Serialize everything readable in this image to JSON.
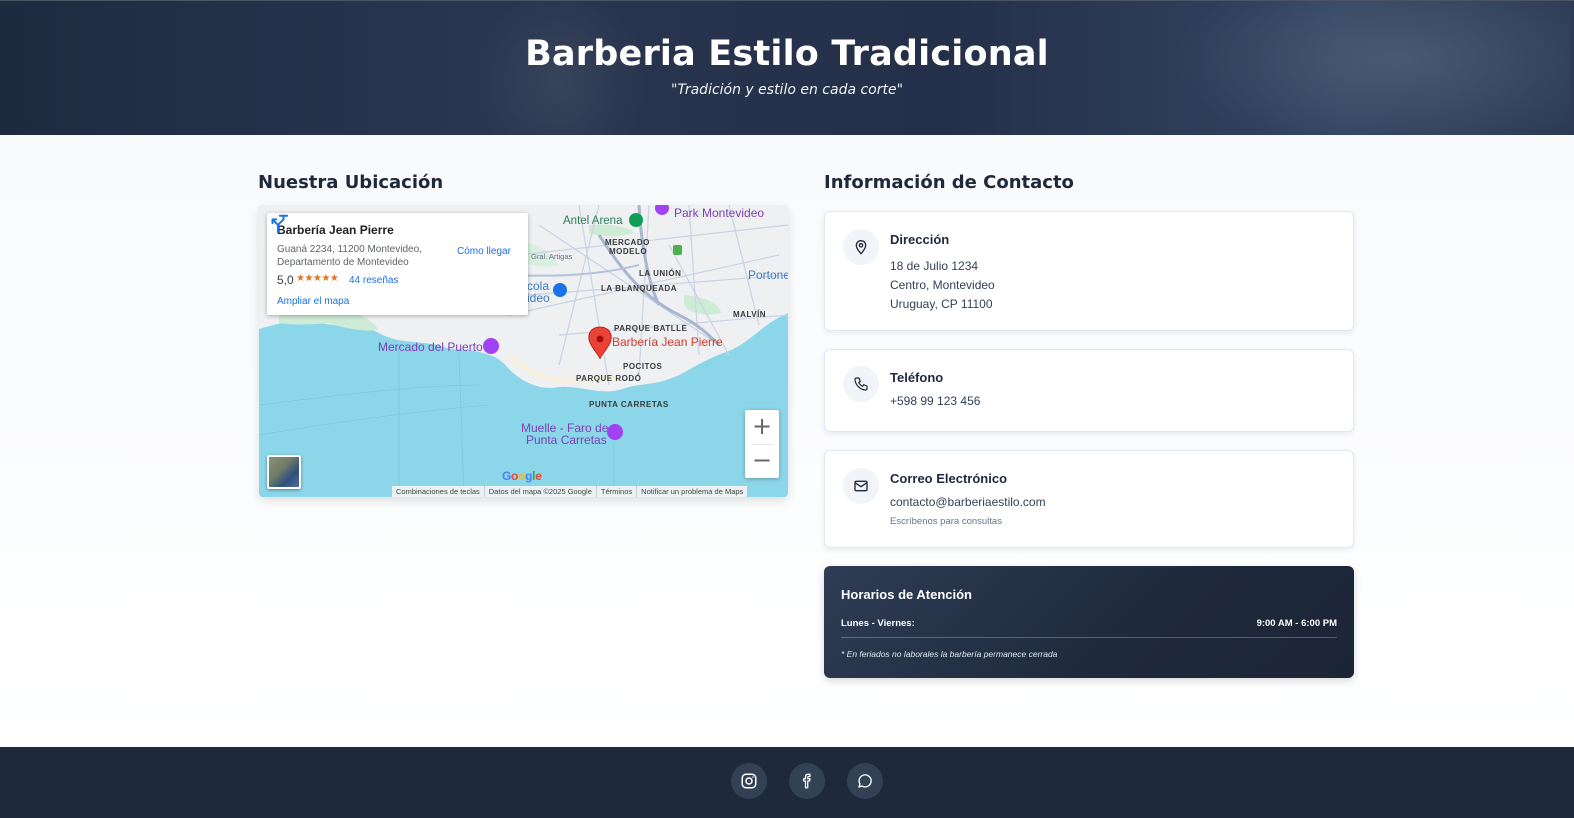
{
  "header": {
    "title": "Barberia Estilo Tradicional",
    "subtitle": "\"Tradición y estilo en cada corte\""
  },
  "location": {
    "section_title": "Nuestra Ubicación",
    "map": {
      "place_card": {
        "name": "Barbería Jean Pierre",
        "address": "Guaná 2234, 11200 Montevideo, Departamento de Montevideo",
        "rating": "5,0",
        "stars": "★★★★★",
        "reviews": "44 reseñas",
        "enlarge": "Ampliar el mapa",
        "directions": "Cómo llegar"
      },
      "labels": {
        "antel_arena": "Antel Arena",
        "park_montevideo": "Park Montevideo",
        "mercado_modelo_1": "MERCADO",
        "mercado_modelo_2": "MODELO",
        "gral_artigas": "Gral. Artigas",
        "la_union": "LA UNIÓN",
        "la_blanqueada": "LA BLANQUEADA",
        "portones": "Portone",
        "malvin": "MALVÍN",
        "parque_batlle": "PARQUE BATLLE",
        "pin_label": "Barbería Jean Pierre",
        "mercado_puerto": "Mercado del Puerto",
        "parque_rodo": "PARQUE RODÓ",
        "pocitos": "POCITOS",
        "punta_carretas": "PUNTA CARRETAS",
        "muelle_1": "Muelle - Faro de",
        "muelle_2": "Punta Carretas",
        "cola_1": "cola",
        "cola_2": "ideo"
      },
      "zoom_in": "+",
      "zoom_out": "−",
      "google": "Google",
      "attribution": [
        "Combinaciones de teclas",
        "Datos del mapa ©2025 Google",
        "Términos",
        "Notificar un problema de Maps"
      ]
    }
  },
  "contact": {
    "section_title": "Información de Contacto",
    "address": {
      "title": "Dirección",
      "lines": [
        "18 de Julio 1234",
        "Centro, Montevideo",
        "Uruguay, CP 11100"
      ]
    },
    "phone": {
      "title": "Teléfono",
      "value": "+598 99 123 456"
    },
    "email": {
      "title": "Correo Electrónico",
      "value": "contacto@barberiaestilo.com",
      "note": "Escríbenos para consultas"
    },
    "hours": {
      "title": "Horarios de Atención",
      "day": "Lunes - Viernes:",
      "time": "9:00 AM - 6:00 PM",
      "note": "* En feriados no laborales la barbería permanece cerrada"
    }
  },
  "footer": {
    "icons": [
      "instagram-icon",
      "facebook-icon",
      "whatsapp-icon"
    ]
  },
  "colors": {
    "dark_navy": "#1e293b",
    "pin_red": "#ea4335",
    "link_blue": "#1a73e8"
  }
}
